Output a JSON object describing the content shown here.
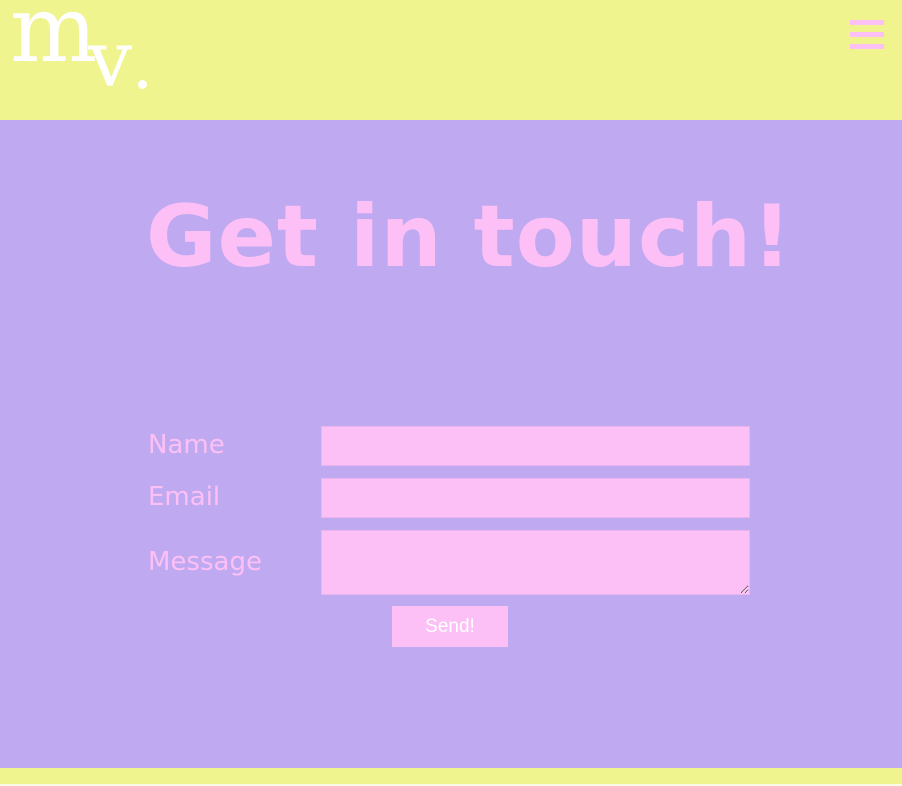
{
  "header": {
    "logo": {
      "m": "m",
      "v": "v"
    },
    "menu_icon": "hamburger-menu-icon"
  },
  "main": {
    "title": "Get in touch!",
    "form": {
      "name_label": "Name",
      "name_value": "",
      "email_label": "Email",
      "email_value": "",
      "message_label": "Message",
      "message_value": "",
      "send_label": "Send!"
    }
  },
  "colors": {
    "header_bg": "#f0f48e",
    "main_bg": "#bfa9f0",
    "accent_pink": "#fdc0f6",
    "logo": "#ffffff"
  }
}
